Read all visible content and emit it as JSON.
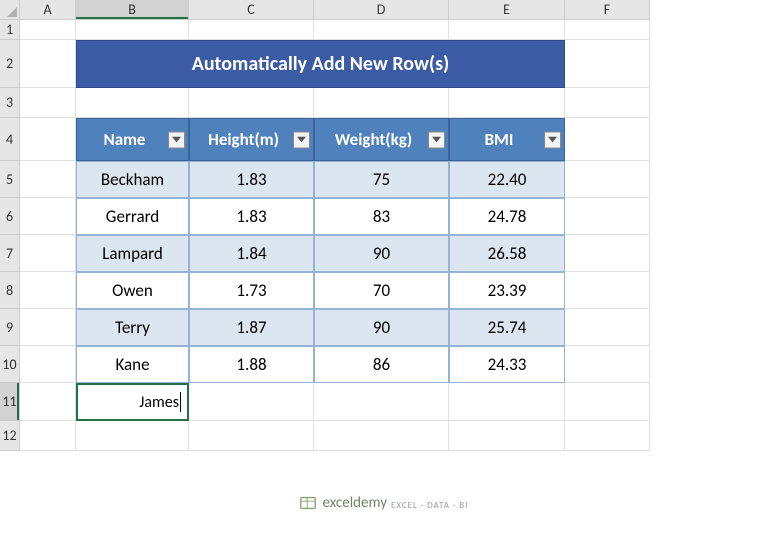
{
  "columns": [
    "A",
    "B",
    "C",
    "D",
    "E",
    "F"
  ],
  "rows": [
    "1",
    "2",
    "3",
    "4",
    "5",
    "6",
    "7",
    "8",
    "9",
    "10",
    "11",
    "12"
  ],
  "title": "Automatically Add New Row(s)",
  "table": {
    "headers": [
      "Name",
      "Height(m)",
      "Weight(kg)",
      "BMI"
    ],
    "rows": [
      {
        "name": "Beckham",
        "height": "1.83",
        "weight": "75",
        "bmi": "22.40"
      },
      {
        "name": "Gerrard",
        "height": "1.83",
        "weight": "83",
        "bmi": "24.78"
      },
      {
        "name": "Lampard",
        "height": "1.84",
        "weight": "90",
        "bmi": "26.58"
      },
      {
        "name": "Owen",
        "height": "1.73",
        "weight": "70",
        "bmi": "23.39"
      },
      {
        "name": "Terry",
        "height": "1.87",
        "weight": "90",
        "bmi": "25.74"
      },
      {
        "name": "Kane",
        "height": "1.88",
        "weight": "86",
        "bmi": "24.33"
      }
    ]
  },
  "active_cell": {
    "ref": "B11",
    "value": "James"
  },
  "branding": {
    "name": "exceldemy",
    "tagline": "EXCEL · DATA · BI"
  },
  "chart_data": {
    "type": "table",
    "title": "Automatically Add New Row(s)",
    "columns": [
      "Name",
      "Height(m)",
      "Weight(kg)",
      "BMI"
    ],
    "rows": [
      [
        "Beckham",
        1.83,
        75,
        22.4
      ],
      [
        "Gerrard",
        1.83,
        83,
        24.78
      ],
      [
        "Lampard",
        1.84,
        90,
        26.58
      ],
      [
        "Owen",
        1.73,
        70,
        23.39
      ],
      [
        "Terry",
        1.87,
        90,
        25.74
      ],
      [
        "Kane",
        1.88,
        86,
        24.33
      ]
    ]
  }
}
